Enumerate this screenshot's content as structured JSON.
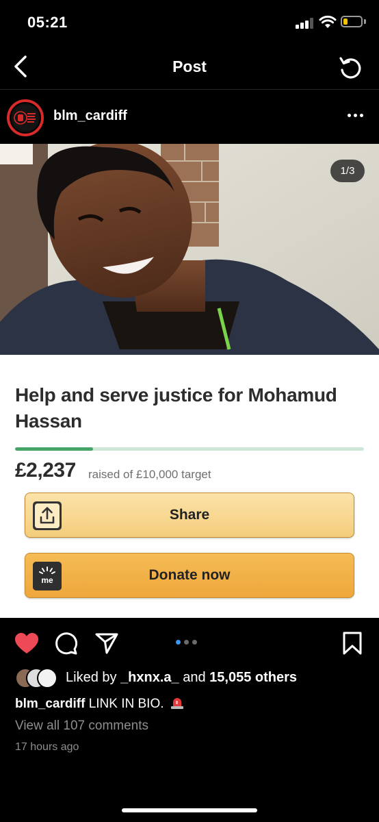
{
  "status_bar": {
    "time": "05:21",
    "battery_level": 0.25
  },
  "nav": {
    "title": "Post",
    "back_icon": "chevron-left-icon",
    "refresh_icon": "refresh-icon"
  },
  "post": {
    "username": "blm_cardiff",
    "avatar_icon": "raised-fist-logo",
    "image_counter": "1/3",
    "carousel_pages": 3,
    "carousel_active": 1
  },
  "fundraiser": {
    "title": "Help and serve justice for Mohamud Hassan",
    "raised": "£2,237",
    "raised_text": "raised of £10,000 target",
    "progress": 0.2237,
    "share_label": "Share",
    "donate_label": "Donate now",
    "share_icon": "share-upload-icon",
    "donate_icon": "gofundme-logo-icon",
    "colors": {
      "progress": "#45a568",
      "share_button": "#f8d891",
      "donate_button": "#f2b247"
    }
  },
  "actions": {
    "liked": true,
    "like_color": "#ed4956",
    "icons": [
      "heart-icon",
      "comment-icon",
      "send-icon",
      "bookmark-icon"
    ]
  },
  "meta": {
    "liked_prefix": "Liked by",
    "liked_user": "_hxnx.a_",
    "liked_and": "and",
    "liked_others": "15,055 others",
    "caption_user": "blm_cardiff",
    "caption_text": "LINK IN BIO.",
    "caption_emoji": "siren-emoji",
    "view_comments": "View all 107 comments",
    "time_ago": "17 hours ago"
  }
}
